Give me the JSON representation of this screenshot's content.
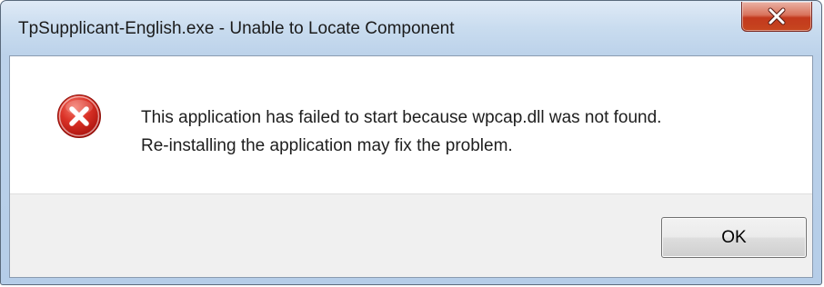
{
  "window": {
    "title": "TpSupplicant-English.exe -  Unable to Locate Component",
    "close_icon": "close-icon"
  },
  "message": {
    "icon": "error-icon",
    "line1": "This application has failed to start because wpcap.dll was not found.",
    "line2": "Re-installing the application may fix the problem."
  },
  "buttons": {
    "ok_label": "OK"
  },
  "colors": {
    "error_red": "#c7231b",
    "close_button_red": "#c6461f"
  }
}
